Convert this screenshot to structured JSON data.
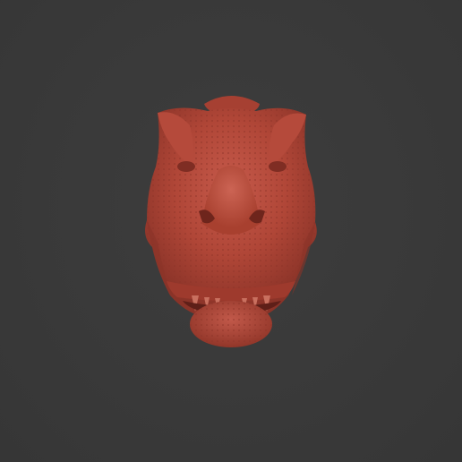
{
  "scene": {
    "background_color": "#3a3a3a",
    "model_color": "#b5483c",
    "model_shadow_color": "#7a2a22",
    "model_highlight_color": "#d0695a",
    "subject": "trex-head-sculpt"
  }
}
